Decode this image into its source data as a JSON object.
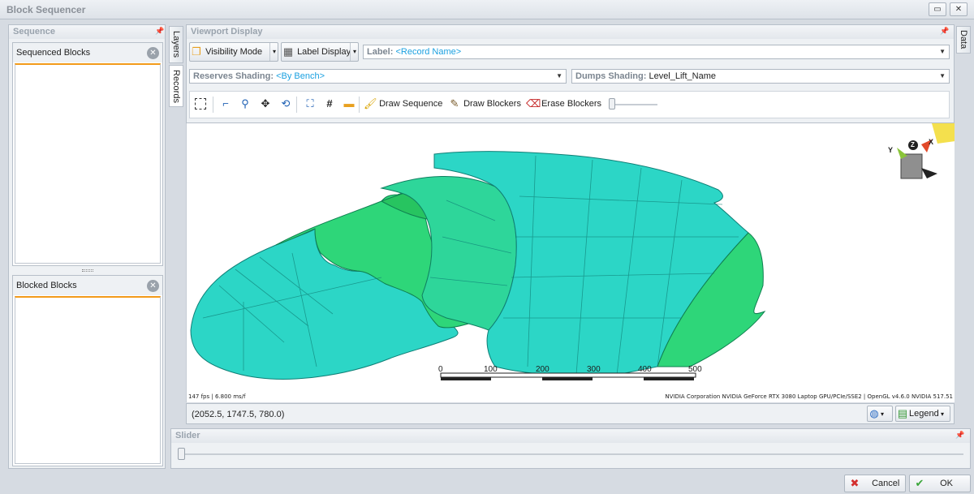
{
  "window": {
    "title": "Block Sequencer",
    "restore_label": "▭",
    "close_label": "✕"
  },
  "sequence": {
    "title": "Sequence",
    "sequenced_label": "Sequenced Blocks",
    "blocked_label": "Blocked Blocks"
  },
  "side_tabs": {
    "layers": "Layers",
    "records": "Records",
    "data": "Data"
  },
  "viewport_display": {
    "title": "Viewport Display",
    "visibility_mode": "Visibility Mode",
    "label_display": "Label Display",
    "label_prefix": "Label:",
    "label_value": "<Record Name>",
    "reserves_prefix": "Reserves Shading:",
    "reserves_value": "<By Bench>",
    "dumps_prefix": "Dumps Shading:",
    "dumps_value": "Level_Lift_Name",
    "draw_sequence": "Draw Sequence",
    "draw_blockers": "Draw Blockers",
    "erase_blockers": "Erase Blockers"
  },
  "viewport": {
    "fps": "147 fps | 6.800 ms/f",
    "renderer": "NVIDIA Corporation NVIDIA GeForce RTX 3080 Laptop GPU/PCIe/SSE2 | OpenGL v4.6.0 NVIDIA 517.51",
    "scale_ticks": [
      "0",
      "100",
      "200",
      "300",
      "400",
      "500"
    ],
    "axis_y": "Y",
    "axis_z": "Z",
    "axis_x": "X"
  },
  "status": {
    "coords": "(2052.5, 1747.5, 780.0)",
    "legend": "Legend"
  },
  "slider": {
    "title": "Slider"
  },
  "footer": {
    "cancel": "Cancel",
    "ok": "OK"
  },
  "colors": {
    "accent": "#f29a1a",
    "block_cyan": "#2cd6c6",
    "block_green": "#2ed679"
  }
}
